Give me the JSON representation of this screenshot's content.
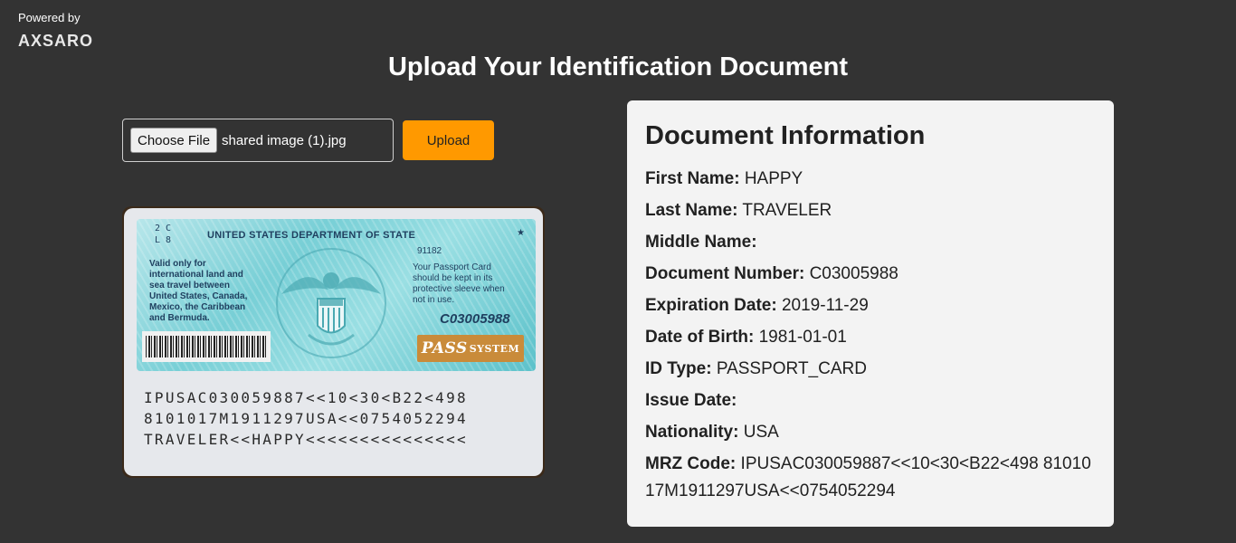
{
  "brand": {
    "powered_by": "Powered by",
    "name": "AXSARO"
  },
  "page": {
    "title": "Upload Your Identification Document"
  },
  "upload_form": {
    "choose_file_label": "Choose File",
    "selected_file_name": "shared image (1).jpg",
    "upload_label": "Upload",
    "upload_color": "#ff9900"
  },
  "card_image": {
    "header": "UNITED STATES DEPARTMENT OF STATE",
    "corner_code": "2 C\nL 8",
    "left_text": "Valid only for\ninternational land and\nsea travel between\nUnited States, Canada,\nMexico, the Caribbean\nand Bermuda.",
    "serial": "91182",
    "right_text": "Your Passport Card\nshould be kept in its\nprotective sleeve when\nnot in use.",
    "document_number": "C03005988",
    "pass_label": "PASS",
    "pass_sub": "SYSTEM",
    "mrz_lines": [
      "IPUSAC030059887<<10<30<B22<498",
      "8101017M1911297USA<<0754052294",
      "TRAVELER<<HAPPY<<<<<<<<<<<<<<<"
    ]
  },
  "document_info": {
    "title": "Document Information",
    "fields": [
      {
        "label": "First Name:",
        "value": "HAPPY"
      },
      {
        "label": "Last Name:",
        "value": "TRAVELER"
      },
      {
        "label": "Middle Name:",
        "value": ""
      },
      {
        "label": "Document Number:",
        "value": "C03005988"
      },
      {
        "label": "Expiration Date:",
        "value": "2019-11-29"
      },
      {
        "label": "Date of Birth:",
        "value": "1981-01-01"
      },
      {
        "label": "ID Type:",
        "value": "PASSPORT_CARD"
      },
      {
        "label": "Issue Date:",
        "value": ""
      },
      {
        "label": "Nationality:",
        "value": "USA"
      },
      {
        "label": "MRZ Code:",
        "value": "IPUSAC030059887<<10<30<B22<498 8101017M1911297USA<<0754052294"
      }
    ]
  }
}
